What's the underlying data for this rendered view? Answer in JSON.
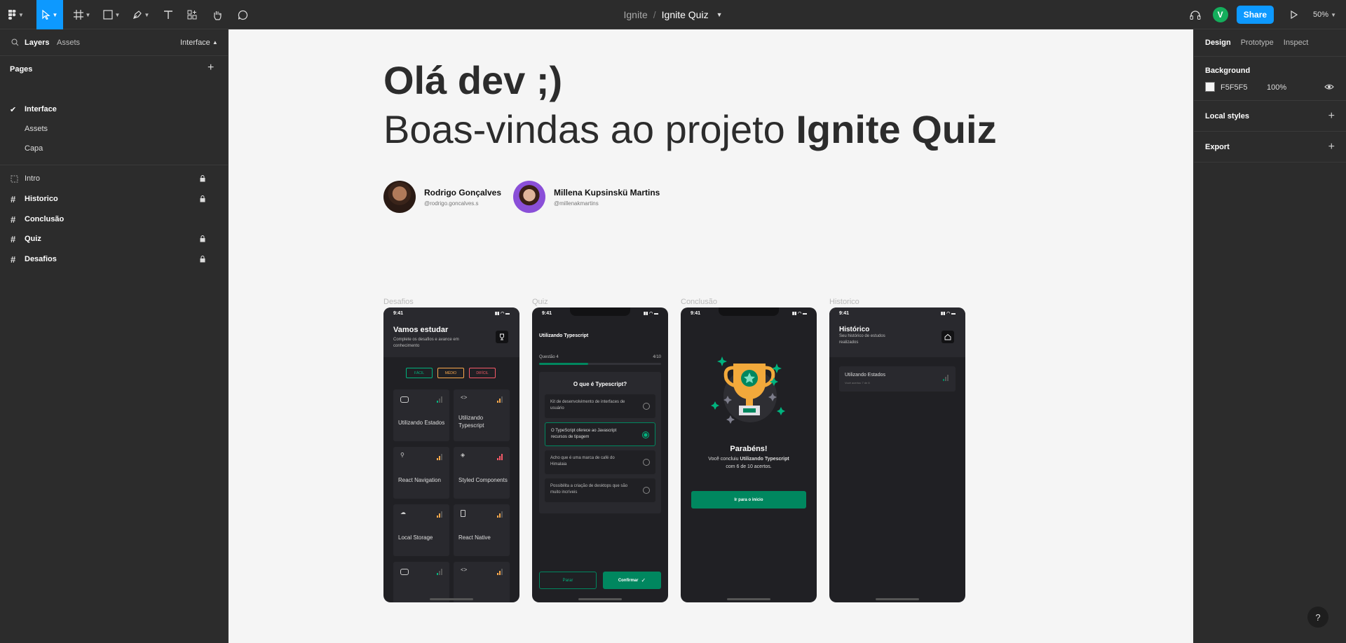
{
  "toolbar": {
    "tools": [
      "main-menu",
      "move",
      "frame",
      "shape",
      "pen",
      "text",
      "resources",
      "hand",
      "comment"
    ]
  },
  "file": {
    "project": "Ignite",
    "separator": "/",
    "name": "Ignite Quiz"
  },
  "header_right": {
    "avatar_letter": "V",
    "share_label": "Share",
    "zoom": "50%"
  },
  "left_panel": {
    "tab_layers": "Layers",
    "tab_assets": "Assets",
    "page_selector": "Interface",
    "pages_title": "Pages",
    "pages": [
      {
        "label": "Interface",
        "current": true
      },
      {
        "label": "Assets",
        "current": false
      },
      {
        "label": "Capa",
        "current": false
      }
    ],
    "layers": [
      {
        "label": "Intro",
        "locked": true,
        "icon": "section"
      },
      {
        "label": "Historico",
        "locked": true,
        "icon": "frame"
      },
      {
        "label": "Conclusão",
        "locked": false,
        "icon": "frame"
      },
      {
        "label": "Quiz",
        "locked": true,
        "icon": "frame"
      },
      {
        "label": "Desafios",
        "locked": true,
        "icon": "frame"
      }
    ]
  },
  "right_panel": {
    "tabs": [
      "Design",
      "Prototype",
      "Inspect"
    ],
    "background_title": "Background",
    "background_hex": "F5F5F5",
    "background_opacity": "100%",
    "local_styles": "Local styles",
    "export": "Export"
  },
  "canvas": {
    "greeting": "Olá dev ;)",
    "welcome_prefix": "Boas-vindas ao projeto ",
    "welcome_bold": "Ignite Quiz",
    "authors": [
      {
        "name": "Rodrigo Gonçalves",
        "handle": "@rodrigo.goncalves.s"
      },
      {
        "name": "Millena Kupsinskü Martins",
        "handle": "@millenakmartins"
      }
    ],
    "frames": {
      "desafios": {
        "label": "Desafios",
        "time": "9:41",
        "title": "Vamos estudar",
        "subtitle": "Complete os desafios e avance em conhecimento",
        "filters": [
          "FÁCIL",
          "MÉDIO",
          "DIFÍCIL"
        ],
        "cards": [
          "Utilizando Estados",
          "Utilizando Typescript",
          "React Navigation",
          "Styled Components",
          "Local Storage",
          "React Native",
          "",
          ""
        ]
      },
      "quiz": {
        "label": "Quiz",
        "time": "9:41",
        "title": "Utilizando Typescript",
        "question_label": "Questão 4",
        "question_count": "4/10",
        "progress": 0.4,
        "question": "O que é Typescript?",
        "options": [
          "Kit de desenvolvimento de interfaces de usuário",
          "O TypeScript oferece ao Javascript recursos de tipagem",
          "Acho que é uma marca de café do Himalaia",
          "Possibilita a criação de desktops que são muito incríveis"
        ],
        "selected_option": 1,
        "stop_label": "Parar",
        "confirm_label": "Confirmar"
      },
      "conclusao": {
        "label": "Conclusão",
        "time": "9:41",
        "title": "Parabéns!",
        "line1_prefix": "Você concluiu ",
        "line1_bold": "Utilizando Typescript",
        "line2": "com 6 de 10 acertos.",
        "button": "Ir para o início"
      },
      "historico": {
        "label": "Historico",
        "time": "9:41",
        "title": "Histórico",
        "subtitle": "Seu histórico de estudos realizados",
        "item_title": "Utilizando Estados",
        "item_sub": "Você acertou 7 de 8"
      }
    }
  },
  "help_label": "?",
  "colors": {
    "accent": "#0d99ff",
    "quiz_green": "#00875f",
    "brand_bg": "#f5f5f5"
  }
}
